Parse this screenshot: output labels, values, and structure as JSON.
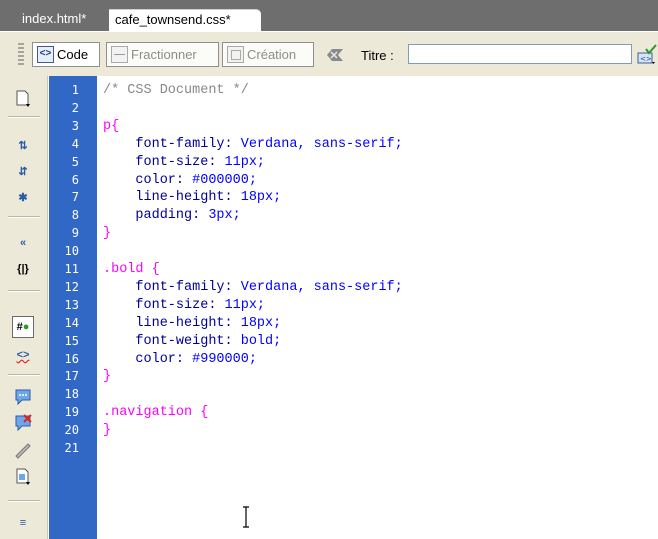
{
  "tabs": [
    {
      "label": "index.html*",
      "active": false
    },
    {
      "label": "cafe_townsend.css*",
      "active": true
    }
  ],
  "toolbar": {
    "code_label": "Code",
    "split_label": "Fractionner",
    "design_label": "Création",
    "title_label": "Titre :",
    "title_value": ""
  },
  "left_toolbar": {
    "icons": [
      "open-documents-icon",
      "collapse-full-tag-icon",
      "collapse-selection-icon",
      "expand-all-icon",
      "select-parent-tag-icon",
      "balance-braces-icon",
      "line-numbers-icon",
      "highlight-invalid-code-icon",
      "apply-comment-icon",
      "remove-comment-icon",
      "wrap-tag-icon",
      "recent-snippets-icon",
      "indent-code-icon"
    ]
  },
  "editor": {
    "line_numbers": [
      "1",
      "2",
      "3",
      "4",
      "5",
      "6",
      "7",
      "8",
      "9",
      "10",
      "11",
      "12",
      "13",
      "14",
      "15",
      "16",
      "17",
      "18",
      "19",
      "20",
      "21"
    ],
    "lines": [
      [
        {
          "t": "/* CSS Document */",
          "k": "comment"
        }
      ],
      [],
      [
        {
          "t": "p{",
          "k": "sel"
        }
      ],
      [
        {
          "t": "    font-family: ",
          "k": "prop"
        },
        {
          "t": "Verdana, sans-serif;",
          "k": "val"
        }
      ],
      [
        {
          "t": "    font-size: ",
          "k": "prop"
        },
        {
          "t": "11px;",
          "k": "val"
        }
      ],
      [
        {
          "t": "    color: ",
          "k": "prop"
        },
        {
          "t": "#000000;",
          "k": "val"
        }
      ],
      [
        {
          "t": "    line-height: ",
          "k": "prop"
        },
        {
          "t": "18px;",
          "k": "val"
        }
      ],
      [
        {
          "t": "    padding: ",
          "k": "prop"
        },
        {
          "t": "3px;",
          "k": "val"
        }
      ],
      [
        {
          "t": "}",
          "k": "brace"
        }
      ],
      [],
      [
        {
          "t": ".bold {",
          "k": "sel"
        }
      ],
      [
        {
          "t": "    font-family: ",
          "k": "prop"
        },
        {
          "t": "Verdana, sans-serif;",
          "k": "val"
        }
      ],
      [
        {
          "t": "    font-size: ",
          "k": "prop"
        },
        {
          "t": "11px;",
          "k": "val"
        }
      ],
      [
        {
          "t": "    line-height: ",
          "k": "prop"
        },
        {
          "t": "18px;",
          "k": "val"
        }
      ],
      [
        {
          "t": "    font-weight: ",
          "k": "prop"
        },
        {
          "t": "bold;",
          "k": "val"
        }
      ],
      [
        {
          "t": "    color: ",
          "k": "prop"
        },
        {
          "t": "#990000;",
          "k": "val"
        }
      ],
      [
        {
          "t": "}",
          "k": "brace"
        }
      ],
      [],
      [
        {
          "t": ".navigation {",
          "k": "sel"
        }
      ],
      [
        {
          "t": "}",
          "k": "brace"
        }
      ],
      []
    ]
  },
  "colors": {
    "gutter": "#3168c6",
    "comment": "#888888",
    "selector": "#ff00ff",
    "property": "#000099",
    "value": "#0000ff"
  }
}
